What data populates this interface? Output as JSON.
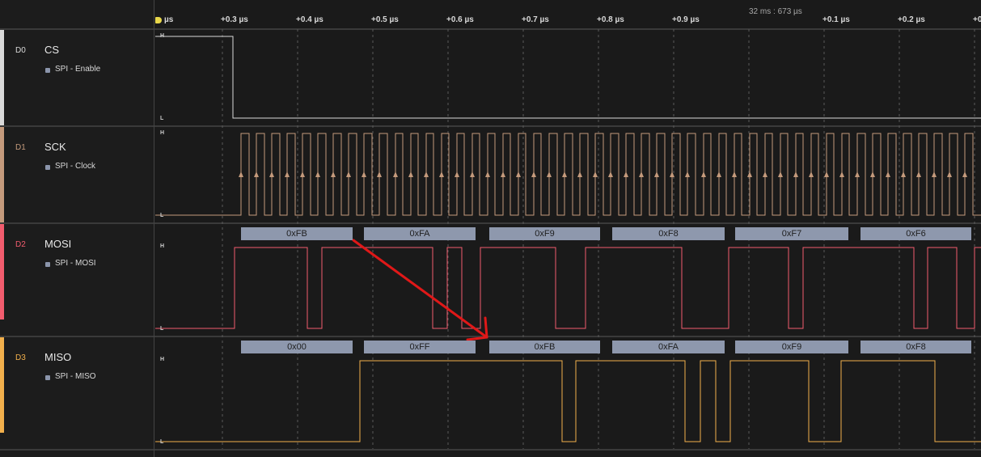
{
  "timeline": {
    "ticks": [
      "µs",
      "+0.3 µs",
      "+0.4 µs",
      "+0.5 µs",
      "+0.6 µs",
      "+0.7 µs",
      "+0.8 µs",
      "+0.9 µs",
      "+0.1 µs",
      "+0.2 µs",
      "+0"
    ],
    "trigger_time": "32 ms : 673 µs"
  },
  "level_labels": {
    "high": "H",
    "low": "L"
  },
  "channels": [
    {
      "id": "D0",
      "name": "CS",
      "analyzer": "SPI - Enable",
      "color": "#d9d9d9"
    },
    {
      "id": "D1",
      "name": "SCK",
      "analyzer": "SPI - Clock",
      "color": "#c49a7c"
    },
    {
      "id": "D2",
      "name": "MOSI",
      "analyzer": "SPI - MOSI",
      "color": "#f25c6e"
    },
    {
      "id": "D3",
      "name": "MISO",
      "analyzer": "SPI - MISO",
      "color": "#f2b04c"
    }
  ],
  "decodes": {
    "mosi": [
      "0xFB",
      "0xFA",
      "0xF9",
      "0xF8",
      "0xF7",
      "0xF6"
    ],
    "miso": [
      "0x00",
      "0xFF",
      "0xFB",
      "0xFA",
      "0xF9",
      "0xF8"
    ]
  },
  "colors": {
    "decode_box": "#8e98ad",
    "annotation_arrow": "#e01818",
    "grid": "#5a5a5a"
  }
}
